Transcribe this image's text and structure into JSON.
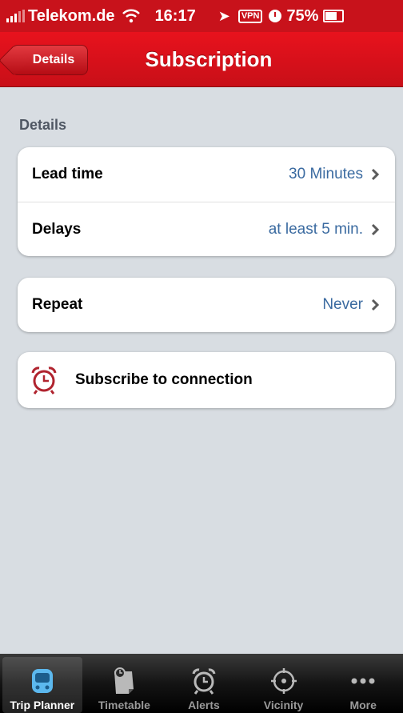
{
  "status_bar": {
    "carrier": "Telekom.de",
    "time": "16:17",
    "vpn": "VPN",
    "battery": "75%",
    "battery_level": 0.75
  },
  "nav": {
    "back_label": "Details",
    "title": "Subscription"
  },
  "section": {
    "header": "Details"
  },
  "settings": [
    {
      "label": "Lead time",
      "value": "30 Minutes"
    },
    {
      "label": "Delays",
      "value": "at least 5 min."
    }
  ],
  "repeat": {
    "label": "Repeat",
    "value": "Never"
  },
  "subscribe": {
    "label": "Subscribe to connection",
    "icon": "alarm-clock-icon"
  },
  "tabs": [
    {
      "label": "Trip Planner",
      "icon": "train-icon",
      "active": true
    },
    {
      "label": "Timetable",
      "icon": "timetable-icon"
    },
    {
      "label": "Alerts",
      "icon": "alarm-clock-icon"
    },
    {
      "label": "Vicinity",
      "icon": "location-target-icon"
    },
    {
      "label": "More",
      "icon": "more-dots-icon"
    }
  ],
  "colors": {
    "brand_red": "#d8101a",
    "value_blue": "#3a6aa0",
    "background": "#d8dde2"
  }
}
